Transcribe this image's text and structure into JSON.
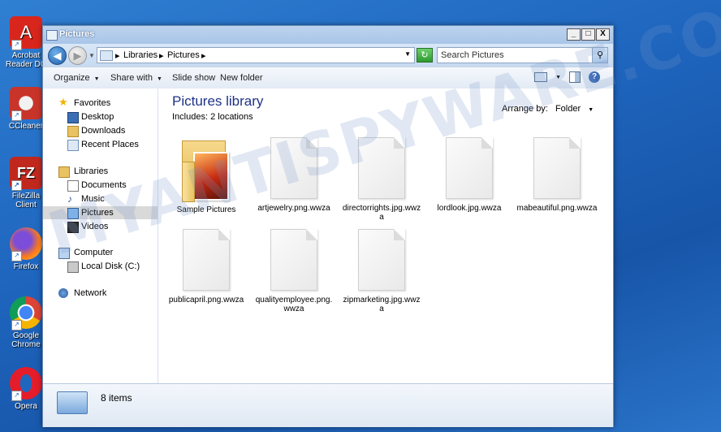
{
  "desktop": {
    "icons": [
      {
        "label": "Acrobat Reader DC",
        "color": "#d8261c",
        "glyph": "A"
      },
      {
        "label": "CCleaner",
        "color": "#c9342a",
        "glyph": "C"
      },
      {
        "label": "FileZilla Client",
        "color": "#c0281d",
        "glyph": "FZ"
      },
      {
        "label": "Firefox",
        "color": "#ff7a1a",
        "glyph": "🦊"
      },
      {
        "label": "Google Chrome",
        "color": "#2e9a44",
        "glyph": "◉"
      },
      {
        "label": "Opera",
        "color": "#e51d2a",
        "glyph": "O"
      }
    ]
  },
  "window": {
    "title": "Pictures",
    "controls": {
      "minimize": "_",
      "maximize": "□",
      "close": "X"
    }
  },
  "address": {
    "crumbs": [
      "Libraries",
      "Pictures"
    ],
    "search_placeholder": "Search Pictures"
  },
  "toolbar": {
    "organize": "Organize",
    "share_with": "Share with",
    "slide_show": "Slide show",
    "new_folder": "New folder"
  },
  "nav": {
    "favorites": "Favorites",
    "desktop": "Desktop",
    "downloads": "Downloads",
    "recent_places": "Recent Places",
    "libraries": "Libraries",
    "documents": "Documents",
    "music": "Music",
    "pictures": "Pictures",
    "videos": "Videos",
    "computer": "Computer",
    "local_disk": "Local Disk (C:)",
    "network": "Network"
  },
  "library": {
    "title": "Pictures library",
    "includes": "Includes:  2 locations",
    "arrange_label": "Arrange by:",
    "arrange_value": "Folder"
  },
  "files": [
    {
      "name": "Sample Pictures",
      "kind": "folder"
    },
    {
      "name": "artjewelry.png.wwza",
      "kind": "file"
    },
    {
      "name": "directorrights.jpg.wwza",
      "kind": "file"
    },
    {
      "name": "lordlook.jpg.wwza",
      "kind": "file"
    },
    {
      "name": "mabeautiful.png.wwza",
      "kind": "file"
    },
    {
      "name": "publicapril.png.wwza",
      "kind": "file"
    },
    {
      "name": "qualityemployee.png.wwza",
      "kind": "file"
    },
    {
      "name": "zipmarketing.jpg.wwza",
      "kind": "file"
    }
  ],
  "status": {
    "count": "8 items"
  },
  "watermark": "MYANTISPYWARE.COM"
}
